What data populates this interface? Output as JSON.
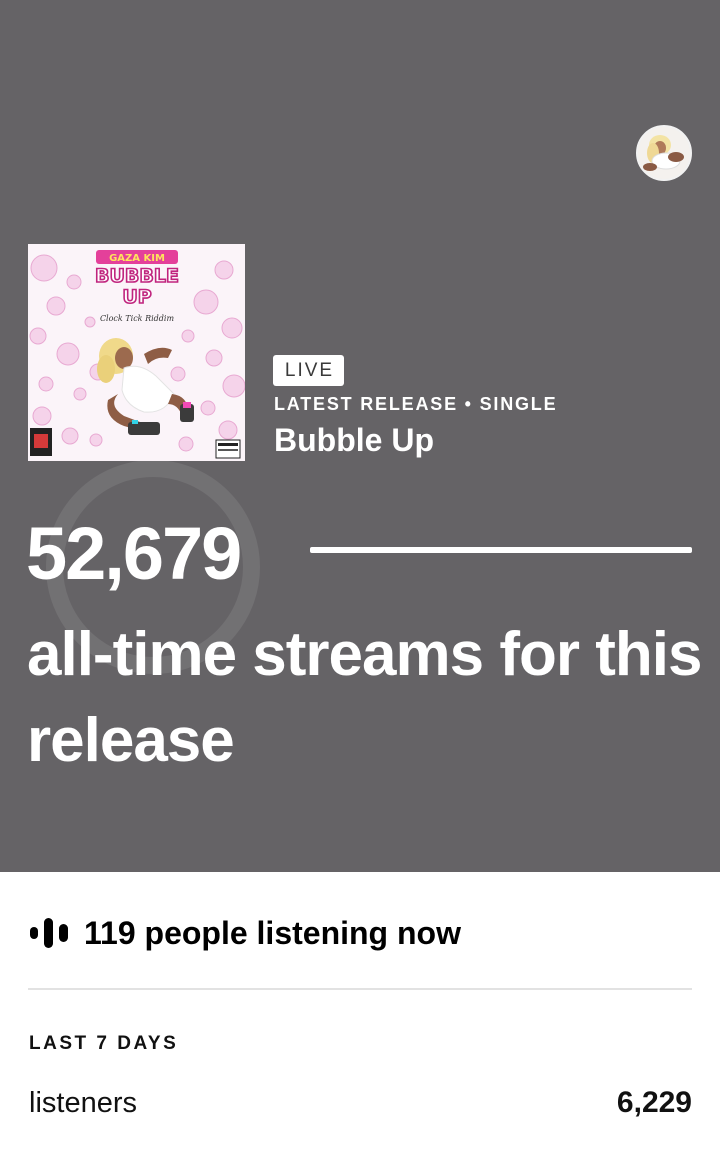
{
  "header": {
    "avatar_icon": "artist-avatar"
  },
  "release": {
    "badge": "LIVE",
    "meta": "LATEST RELEASE • SINGLE",
    "title": "Bubble Up",
    "cover": {
      "artist_text": "GAZA KIM",
      "title_text": "BUBBLE",
      "title_text_2": "UP",
      "subtitle_text": "Clock Tick Riddim"
    }
  },
  "streams": {
    "count": "52,679",
    "caption": "all-time streams for this release"
  },
  "live_listeners": {
    "icon": "sound-bars-icon",
    "text": "119 people listening now"
  },
  "last_7_days": {
    "label": "LAST 7 DAYS",
    "rows": [
      {
        "label": "listeners",
        "value": "6,229"
      }
    ]
  },
  "colors": {
    "hero_background": "#656366",
    "text_light": "#ffffff",
    "text_dark": "#111111",
    "cover_accent": "#e4409a"
  }
}
